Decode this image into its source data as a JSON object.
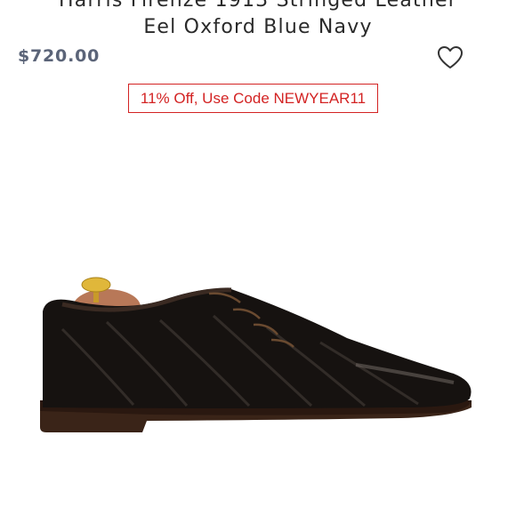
{
  "product": {
    "title_line1": "Harris Firenze 1913 Stringed Leather",
    "title_line2": "Eel Oxford Blue Navy",
    "price": "$720.00",
    "favorite_icon": "heart-outline-icon",
    "promo": "11% Off, Use Code NEWYEAR11",
    "image": "shoe-product-image"
  },
  "colors": {
    "price": "#5b6478",
    "promo": "#d32323"
  }
}
